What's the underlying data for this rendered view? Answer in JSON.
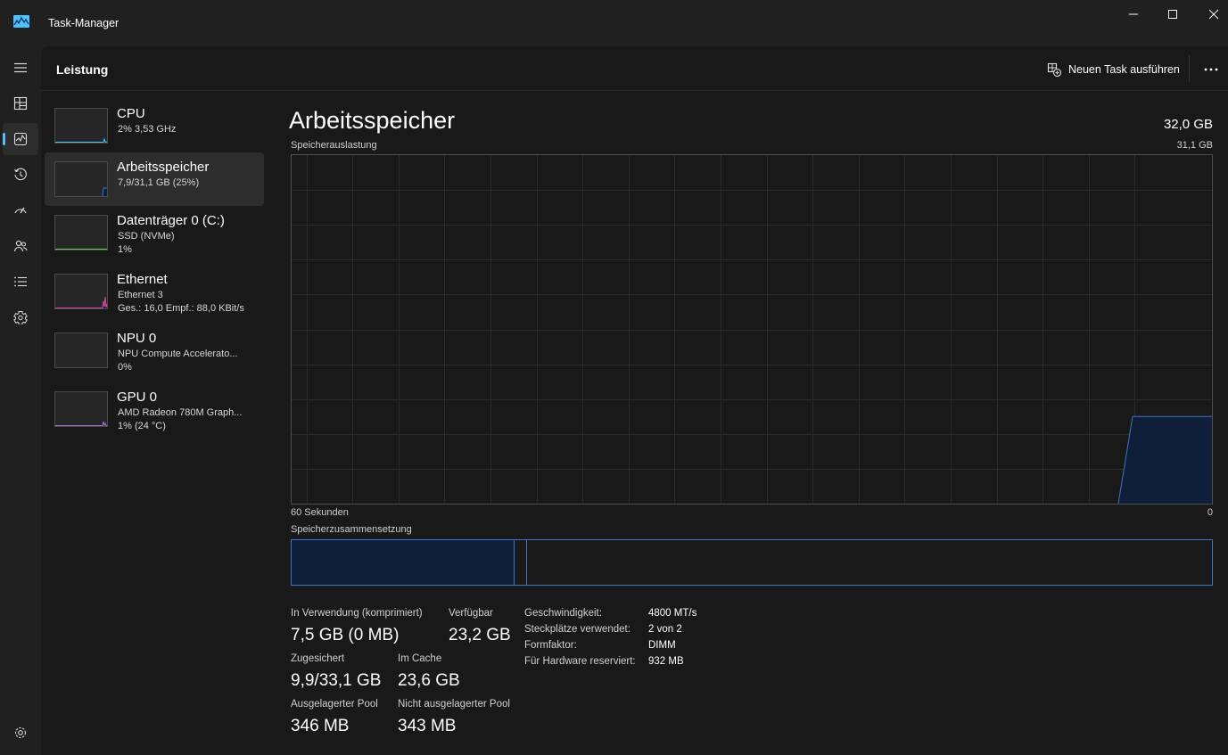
{
  "window": {
    "title": "Task-Manager",
    "accent": "#4cc2ff"
  },
  "nav": {
    "items": [
      {
        "icon": "hamburger-icon"
      },
      {
        "icon": "processes-icon"
      },
      {
        "icon": "performance-icon",
        "active": true
      },
      {
        "icon": "app-history-icon"
      },
      {
        "icon": "startup-apps-icon"
      },
      {
        "icon": "users-icon"
      },
      {
        "icon": "details-icon"
      },
      {
        "icon": "services-icon"
      },
      {
        "icon": "settings-icon"
      }
    ]
  },
  "header": {
    "title": "Leistung",
    "run_task": "Neuen Task ausführen",
    "more": "..."
  },
  "devices": [
    {
      "name": "CPU",
      "line1": "2%  3,53 GHz",
      "line2": ""
    },
    {
      "name": "Arbeitsspeicher",
      "line1": "7,9/31,1 GB (25%)",
      "line2": "",
      "selected": true
    },
    {
      "name": "Datenträger 0 (C:)",
      "line1": "SSD (NVMe)",
      "line2": "1%"
    },
    {
      "name": "Ethernet",
      "line1": "Ethernet 3",
      "line2": "Ges.: 16,0 Empf.: 88,0 KBit/s"
    },
    {
      "name": "NPU 0",
      "line1": "NPU Compute Accelerato...",
      "line2": "0%"
    },
    {
      "name": "GPU 0",
      "line1": "AMD Radeon 780M Graph...",
      "line2": "1% (24 °C)"
    }
  ],
  "detail": {
    "title": "Arbeitsspeicher",
    "total": "32,0 GB",
    "usage_label": "Speicherauslastung",
    "usage_max": "31,1 GB",
    "time_left": "60 Sekunden",
    "time_right": "0",
    "composition_label": "Speicherzusammensetzung",
    "usage_level": 0.25,
    "graph_color": "#3d73c8"
  },
  "stats": {
    "in_use_label": "In Verwendung (komprimiert)",
    "in_use_value": "7,5 GB (0 MB)",
    "available_label": "Verfügbar",
    "available_value": "23,2 GB",
    "committed_label": "Zugesichert",
    "committed_value": "9,9/33,1 GB",
    "cached_label": "Im Cache",
    "cached_value": "23,6 GB",
    "paged_label": "Ausgelagerter Pool",
    "paged_value": "346 MB",
    "nonpaged_label": "Nicht ausgelagerter Pool",
    "nonpaged_value": "343 MB"
  },
  "specs": [
    {
      "key": "Geschwindigkeit:",
      "value": "4800 MT/s"
    },
    {
      "key": "Steckplätze verwendet:",
      "value": "2 von 2"
    },
    {
      "key": "Formfaktor:",
      "value": "DIMM"
    },
    {
      "key": "Für Hardware reserviert:",
      "value": "932 MB"
    }
  ]
}
